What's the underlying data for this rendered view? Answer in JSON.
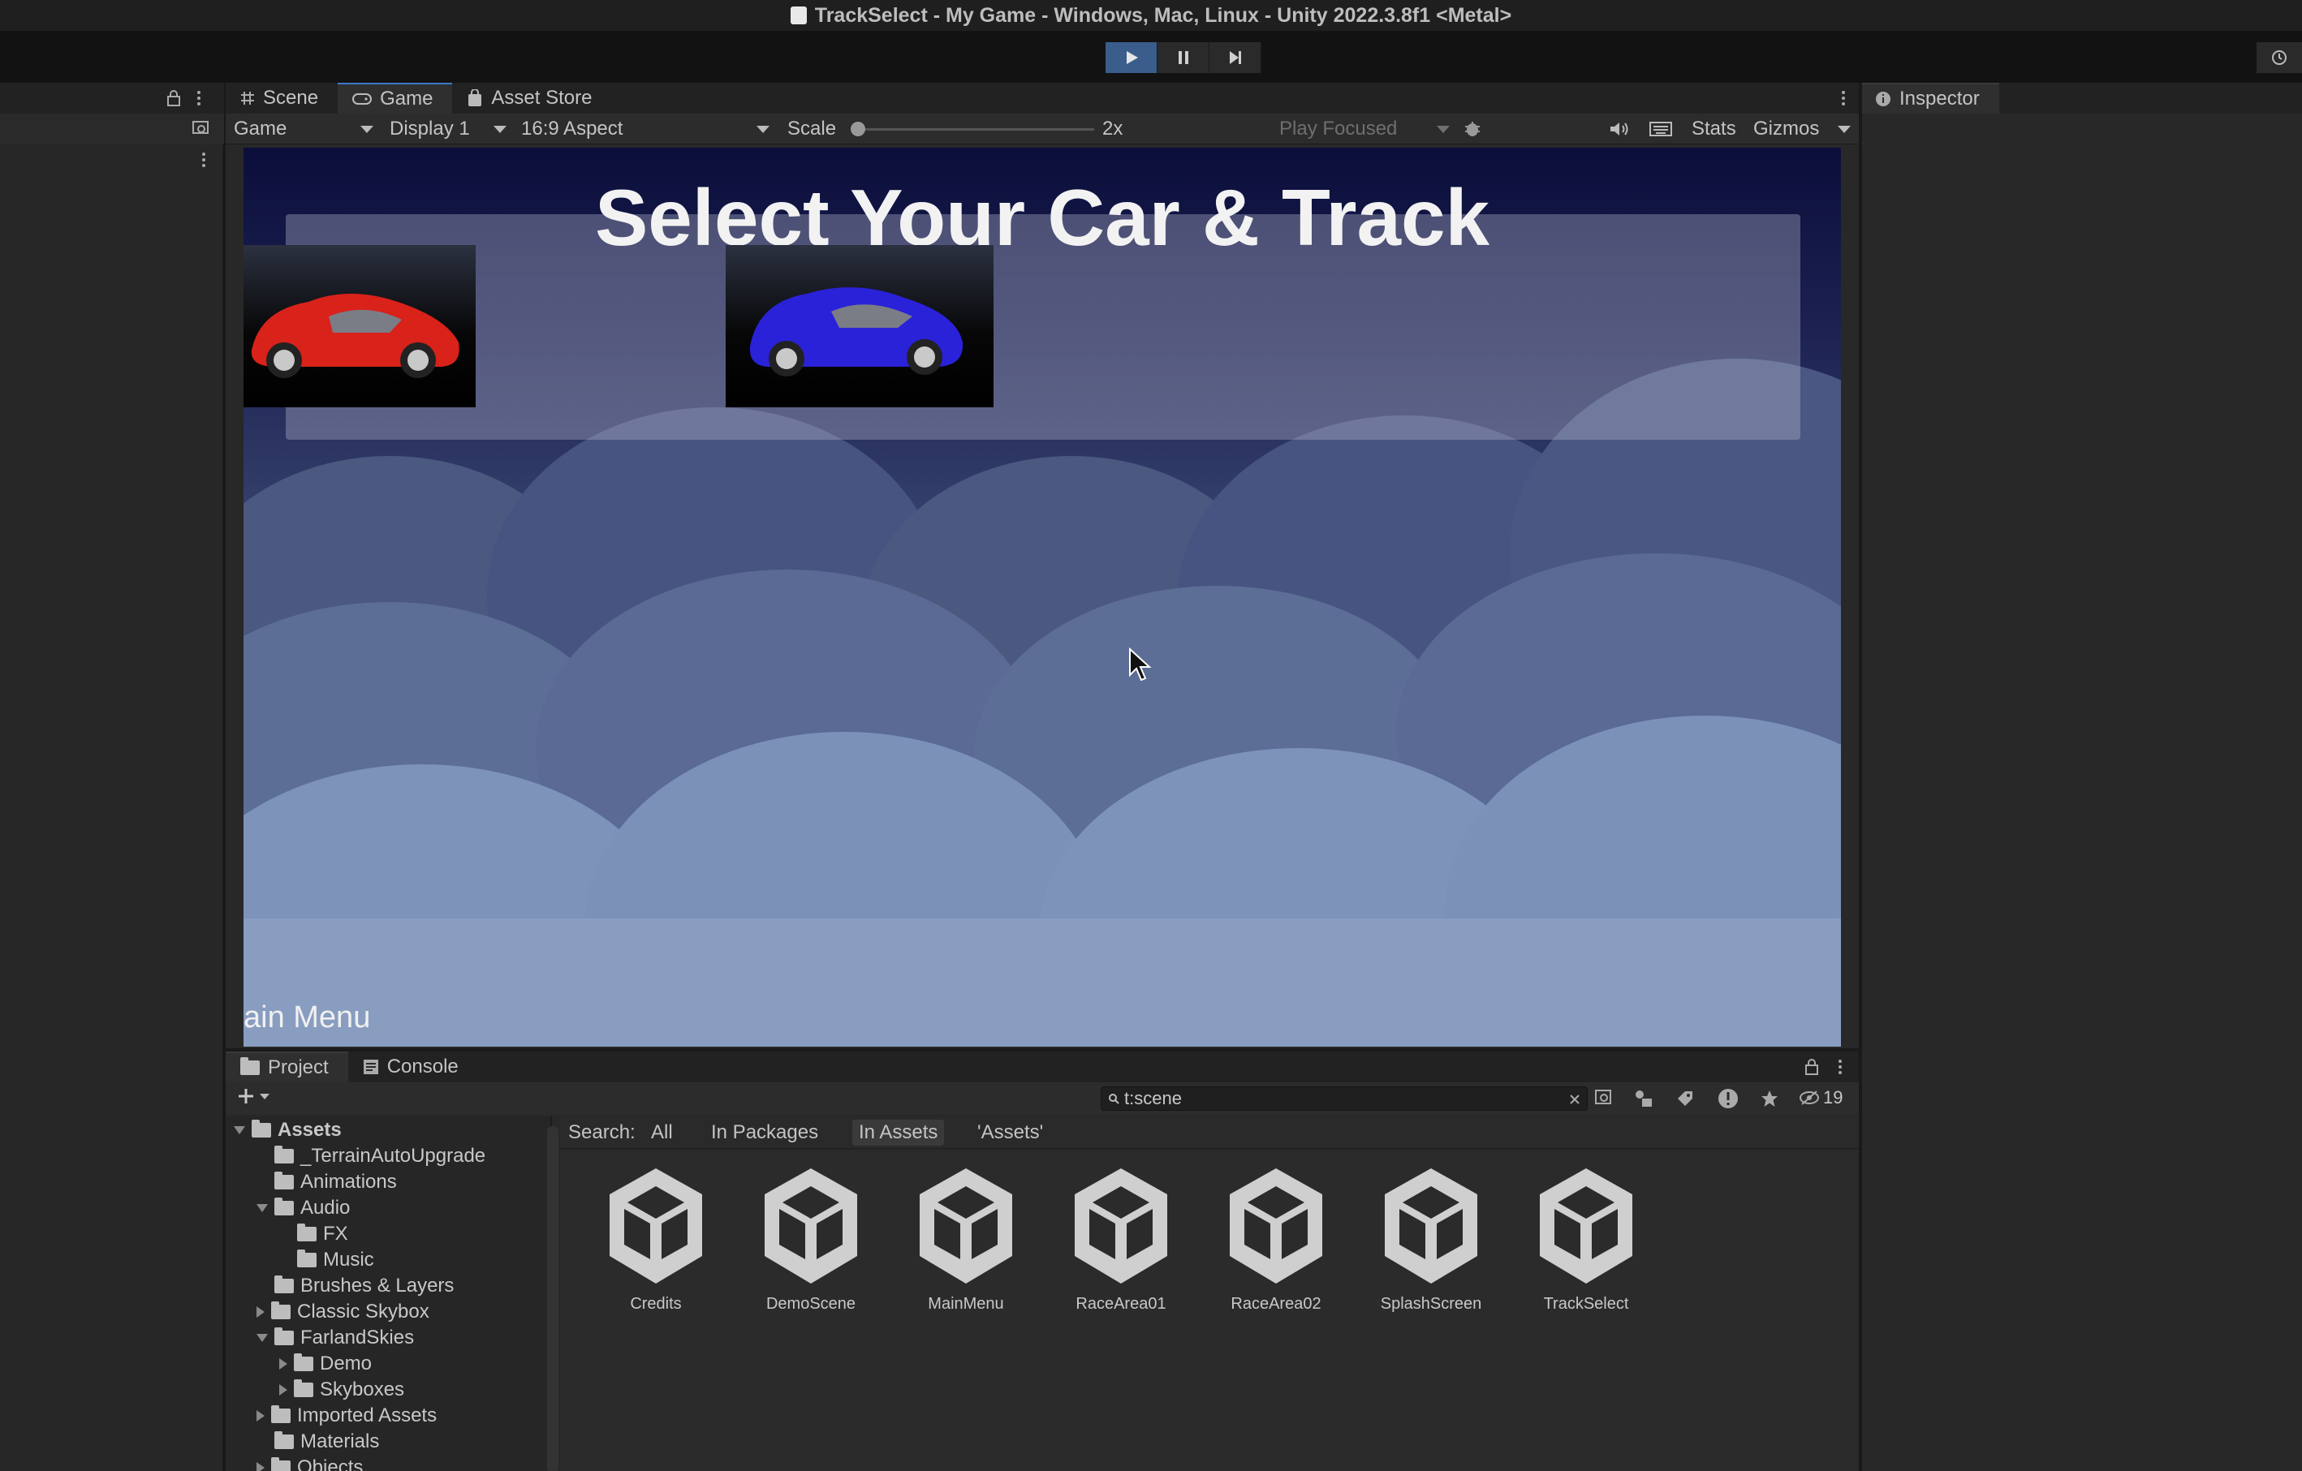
{
  "window": {
    "title": "TrackSelect - My Game - Windows, Mac, Linux - Unity 2022.3.8f1 <Metal>"
  },
  "toolbar": {
    "play_icon": "play-icon",
    "pause_icon": "pause-icon",
    "step_icon": "step-icon",
    "history_icon": "history-icon"
  },
  "game_panel": {
    "tabs": [
      {
        "label": "Scene",
        "icon": "hash-icon"
      },
      {
        "label": "Game",
        "icon": "gamepad-icon"
      },
      {
        "label": "Asset Store",
        "icon": "bag-icon"
      }
    ],
    "game_dropdown": "Game",
    "display_dropdown": "Display 1",
    "aspect_dropdown": "16:9 Aspect",
    "scale_label": "Scale",
    "scale_value": "2x",
    "scale_level": 0,
    "play_focused": "Play Focused",
    "stats": "Stats",
    "gizmos": "Gizmos"
  },
  "game_view": {
    "title": "Select Your Car & Track",
    "cars": [
      {
        "name": "red-car",
        "color": "#d8221a"
      },
      {
        "name": "blue-car",
        "color": "#2a22d8"
      }
    ],
    "bottom_text": "ain Menu"
  },
  "inspector": {
    "tab_label": "Inspector"
  },
  "project_panel": {
    "tabs": [
      {
        "label": "Project",
        "icon": "folder-icon"
      },
      {
        "label": "Console",
        "icon": "console-icon"
      }
    ],
    "search_value": "t:scene",
    "hidden_count": "19",
    "filter": {
      "label": "Search:",
      "all": "All",
      "in_packages": "In Packages",
      "in_assets": "In Assets",
      "assets_quoted": "'Assets'"
    },
    "tree": [
      {
        "label": "Assets",
        "level": 0,
        "arrow": "down",
        "bold": true
      },
      {
        "label": "_TerrainAutoUpgrade",
        "level": 1,
        "arrow": "none"
      },
      {
        "label": "Animations",
        "level": 1,
        "arrow": "none"
      },
      {
        "label": "Audio",
        "level": 1,
        "arrow": "down"
      },
      {
        "label": "FX",
        "level": 2,
        "arrow": "none"
      },
      {
        "label": "Music",
        "level": 2,
        "arrow": "none"
      },
      {
        "label": "Brushes & Layers",
        "level": 1,
        "arrow": "none"
      },
      {
        "label": "Classic Skybox",
        "level": 1,
        "arrow": "right"
      },
      {
        "label": "FarlandSkies",
        "level": 1,
        "arrow": "down"
      },
      {
        "label": "Demo",
        "level": 2,
        "arrow": "right"
      },
      {
        "label": "Skyboxes",
        "level": 2,
        "arrow": "right"
      },
      {
        "label": "Imported Assets",
        "level": 1,
        "arrow": "right"
      },
      {
        "label": "Materials",
        "level": 1,
        "arrow": "none"
      },
      {
        "label": "Objects",
        "level": 1,
        "arrow": "right"
      }
    ],
    "assets": [
      "Credits",
      "DemoScene",
      "MainMenu",
      "RaceArea01",
      "RaceArea02",
      "SplashScreen",
      "TrackSelect"
    ]
  }
}
